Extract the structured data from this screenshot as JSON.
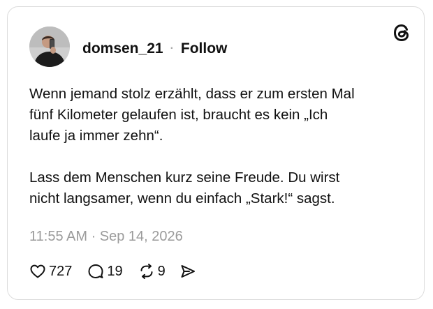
{
  "post": {
    "author": {
      "username": "domsen_21",
      "separator": "·",
      "follow_label": "Follow",
      "avatar_icon": "profile-photo"
    },
    "brand_icon": "threads-logo-icon",
    "paragraphs": [
      "Wenn jemand stolz erzählt, dass er zum ersten Mal\nfünf Kilometer gelaufen ist, braucht es kein „Ich\nlaufe ja immer zehn“.",
      "Lass dem Menschen kurz seine Freude. Du wirst\nnicht langsamer, wenn du einfach „Stark!“ sagst."
    ],
    "timestamp": "11:55 AM · Sep 14, 2026",
    "actions": {
      "like": {
        "icon": "heart-icon",
        "count": "727"
      },
      "reply": {
        "icon": "comment-icon",
        "count": "19"
      },
      "repost": {
        "icon": "repost-icon",
        "count": "9"
      },
      "share": {
        "icon": "send-icon"
      }
    }
  },
  "colors": {
    "text": "#111111",
    "muted": "#9b9b9b",
    "border": "#dcdcdc",
    "background": "#ffffff"
  }
}
